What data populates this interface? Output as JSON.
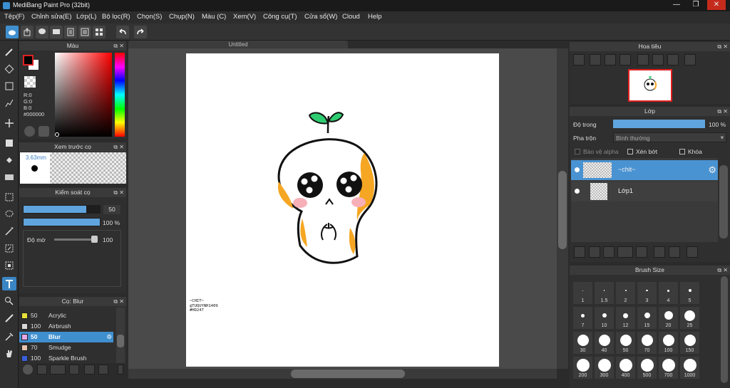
{
  "window": {
    "title": "MediBang Paint Pro (32bit)"
  },
  "menu": [
    "Tệp(F)",
    "Chỉnh sửa(E)",
    "Lớp(L)",
    "Bộ lọc(R)",
    "Chọn(S)",
    "Chụp(N)",
    "Màu (C)",
    "Xem(V)",
    "Công cụ(T)",
    "Cửa sổ(W)",
    "Cloud",
    "Help"
  ],
  "color_panel": {
    "title": "Màu",
    "r": "R:0",
    "g": "G:0",
    "b": "B:0",
    "hex": "#000000",
    "primary": "#000000",
    "secondary": "#ffffff"
  },
  "brush_preview": {
    "title": "Xem trước cọ",
    "size": "3.63mm"
  },
  "brush_control": {
    "title": "Kiểm soát cọ",
    "size_value": "50",
    "size_fill": 0.82,
    "opacity_value": "100 %",
    "opacity_fill": 1.0,
    "blur_label": "Độ mờ",
    "blur_value": "100"
  },
  "brush_list": {
    "title": "Cọ: Blur",
    "items": [
      {
        "value": "50",
        "name": "Acrylic",
        "color": "#e8e13a"
      },
      {
        "value": "100",
        "name": "Airbrush",
        "color": "#d8d8d8"
      },
      {
        "value": "50",
        "name": "Blur",
        "color": "#e8a8e8",
        "selected": true
      },
      {
        "value": "70",
        "name": "Smudge",
        "color": "#e8c4b0"
      },
      {
        "value": "100",
        "name": "Sparkle Brush",
        "color": "#3a5fd8"
      }
    ]
  },
  "canvas": {
    "tab": "Untitled",
    "signature": [
      "~CHIT~",
      "@TUQUYNH1409",
      "#HD247"
    ]
  },
  "navigator": {
    "title": "Hoa tiêu"
  },
  "layer_panel": {
    "title": "Lớp",
    "opacity_label": "Độ trong",
    "opacity_value": "100 %",
    "blend_label": "Pha trộn",
    "blend_value": "Bình thường",
    "protect_alpha": "Bảo vệ alpha",
    "clipping": "Xén bớt",
    "lock": "Khóa",
    "layers": [
      {
        "name": "~chit~",
        "selected": true
      },
      {
        "name": "Lớp1",
        "selected": false
      }
    ]
  },
  "brush_size": {
    "title": "Brush Size",
    "sizes": [
      "1",
      "1.5",
      "2",
      "3",
      "4",
      "5",
      "7",
      "10",
      "12",
      "15",
      "20",
      "25",
      "30",
      "40",
      "50",
      "70",
      "100",
      "150",
      "200",
      "300",
      "400",
      "500",
      "700",
      "1000"
    ]
  }
}
